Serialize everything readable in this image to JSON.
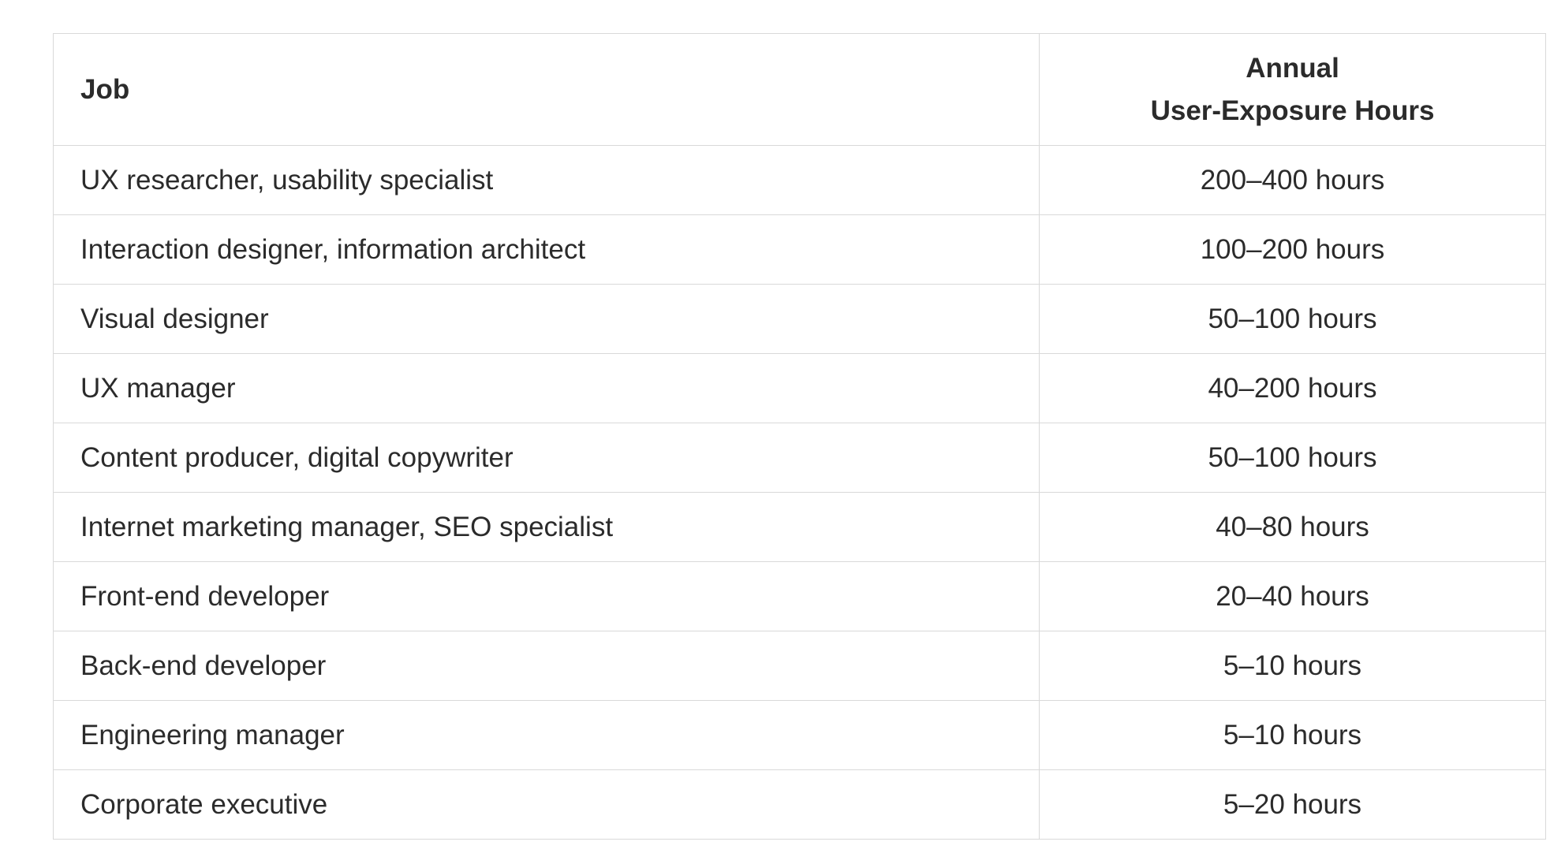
{
  "table": {
    "headers": {
      "job": "Job",
      "hours_line1": "Annual",
      "hours_line2": "User-Exposure Hours"
    },
    "rows": [
      {
        "job": "UX researcher, usability specialist",
        "hours": "200–400 hours"
      },
      {
        "job": "Interaction designer, information architect",
        "hours": "100–200 hours"
      },
      {
        "job": "Visual designer",
        "hours": "50–100 hours"
      },
      {
        "job": "UX manager",
        "hours": "40–200 hours"
      },
      {
        "job": "Content producer, digital copywriter",
        "hours": "50–100 hours"
      },
      {
        "job": "Internet marketing manager, SEO specialist",
        "hours": "40–80 hours"
      },
      {
        "job": "Front-end developer",
        "hours": "20–40 hours"
      },
      {
        "job": "Back-end developer",
        "hours": "5–10 hours"
      },
      {
        "job": "Engineering manager",
        "hours": "5–10 hours"
      },
      {
        "job": "Corporate executive",
        "hours": "5–20 hours"
      }
    ]
  },
  "colors": {
    "text": "#2b2b2b",
    "border": "#d9d9d9",
    "background": "#ffffff"
  }
}
